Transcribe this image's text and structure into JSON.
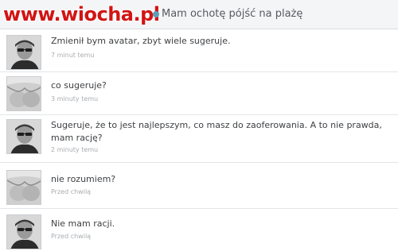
{
  "watermark": {
    "text": "www.wiocha.pl"
  },
  "header": {
    "status_text": "Mam ochotę pójść na plażę",
    "status_dot_color": "#5e9fb8",
    "watermark_color": "#d21414"
  },
  "messages": [
    {
      "avatar": "avatar-man-sunglasses",
      "text": "Zmienił bym avatar, zbyt wiele sugeruje.",
      "time": "7 minut temu"
    },
    {
      "avatar": "avatar-woman",
      "text": "co sugeruje?",
      "time": "3 minuty temu"
    },
    {
      "avatar": "avatar-man-sunglasses",
      "text": "Sugeruje, że to jest najlepszym, co masz do zaoferowania. A to nie prawda, mam rację?",
      "time": "2 minuty temu"
    },
    {
      "avatar": "avatar-woman",
      "text": "nie rozumiem?",
      "time": "Przed chwilą"
    },
    {
      "avatar": "avatar-man-sunglasses",
      "text": "Nie mam racji.",
      "time": "Przed chwilą"
    }
  ]
}
